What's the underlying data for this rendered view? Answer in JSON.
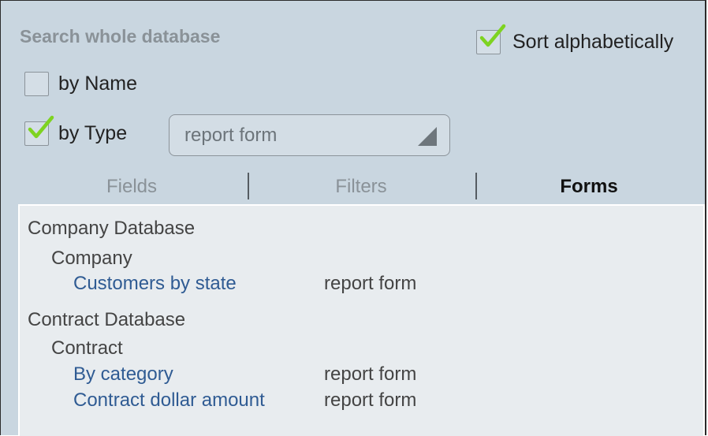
{
  "search": {
    "title": "Search whole database",
    "sort_label": "Sort alphabetically",
    "sort_checked": true,
    "by_name_label": "by Name",
    "by_name_checked": false,
    "by_type_label": "by Type",
    "by_type_checked": true,
    "type_value": "report form"
  },
  "tabs": [
    {
      "label": "Fields",
      "active": false
    },
    {
      "label": "Filters",
      "active": false
    },
    {
      "label": "Forms",
      "active": true
    }
  ],
  "results": {
    "databases": [
      {
        "name": "Company Database",
        "tables": [
          {
            "name": "Company",
            "forms": [
              {
                "name": "Customers by state",
                "type": "report form"
              }
            ]
          }
        ]
      },
      {
        "name": "Contract Database",
        "tables": [
          {
            "name": "Contract",
            "forms": [
              {
                "name": "By category",
                "type": "report form"
              },
              {
                "name": "Contract dollar amount",
                "type": "report form"
              }
            ]
          }
        ]
      }
    ]
  },
  "colors": {
    "panel_bg": "#c9d6e0",
    "list_bg": "#e8ecef",
    "checkmark": "#7ed321",
    "form_link": "#2f5b93"
  }
}
